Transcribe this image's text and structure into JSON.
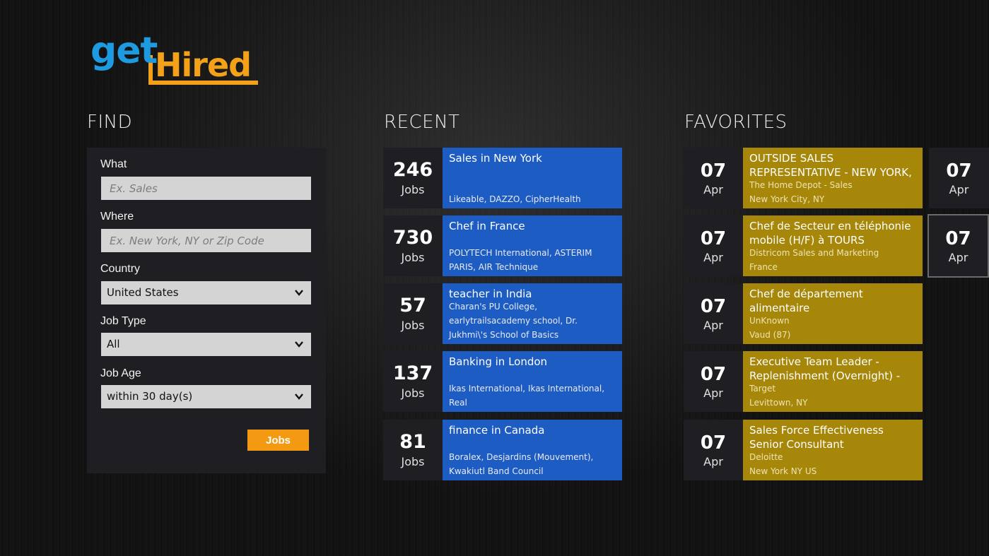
{
  "logo": {
    "get": "get",
    "hired": "Hired"
  },
  "find": {
    "title": "FIND",
    "what_label": "What",
    "what_placeholder": "Ex. Sales",
    "where_label": "Where",
    "where_placeholder": "Ex. New York, NY or Zip Code",
    "country_label": "Country",
    "country_value": "United States",
    "job_type_label": "Job Type",
    "job_type_value": "All",
    "job_age_label": "Job Age",
    "job_age_value": "within 30 day(s)",
    "button_label": "Jobs"
  },
  "recent": {
    "title": "RECENT",
    "items": [
      {
        "count": "246",
        "unit": "Jobs",
        "title": "Sales in New York",
        "companies": "Likeable, DAZZO, CipherHealth"
      },
      {
        "count": "730",
        "unit": "Jobs",
        "title": "Chef in France",
        "companies": "POLYTECH International, ASTERIM PARIS, AIR Technique"
      },
      {
        "count": "57",
        "unit": "Jobs",
        "title": "teacher in India",
        "companies": "Charan's PU College, earlytrailsacademy school, Dr. Jukhmi\\'s School of Basics"
      },
      {
        "count": "137",
        "unit": "Jobs",
        "title": "Banking in London",
        "companies": "Ikas International, Ikas International, Real"
      },
      {
        "count": "81",
        "unit": "Jobs",
        "title": "finance in Canada",
        "companies": "Boralex, Desjardins (Mouvement), Kwakiutl Band Council"
      }
    ]
  },
  "favorites": {
    "title": "FAVORITES",
    "items": [
      {
        "day": "07",
        "month": "Apr",
        "title": "OUTSIDE SALES REPRESENTATIVE - NEW YORK, NY",
        "company": "The Home Depot - Sales",
        "location": "New York City, NY"
      },
      {
        "day": "07",
        "month": "Apr",
        "title": "Chef de Secteur en téléphonie mobile (H/F) à TOURS",
        "company": "Districom Sales and Marketing",
        "location": "France"
      },
      {
        "day": "07",
        "month": "Apr",
        "title": "Chef de département alimentaire",
        "company": "UnKnown",
        "location": "Vaud (87)"
      },
      {
        "day": "07",
        "month": "Apr",
        "title": "Executive Team Leader - Replenishment (Overnight) - Long",
        "company": "Target",
        "location": "Levittown, NY"
      },
      {
        "day": "07",
        "month": "Apr",
        "title": "Sales  Force Effectiveness Senior Consultant",
        "company": "Deloitte",
        "location": "New York NY US"
      }
    ],
    "overflow": [
      {
        "day": "07",
        "month": "Apr"
      },
      {
        "day": "07",
        "month": "Apr"
      }
    ]
  },
  "colors": {
    "accent_blue": "#1d5cc3",
    "accent_gold": "#a6870a",
    "button_orange": "#f39a12",
    "logo_blue": "#1e9be0",
    "logo_orange": "#f4a11a"
  },
  "icons": [
    "chevron-down-icon"
  ]
}
